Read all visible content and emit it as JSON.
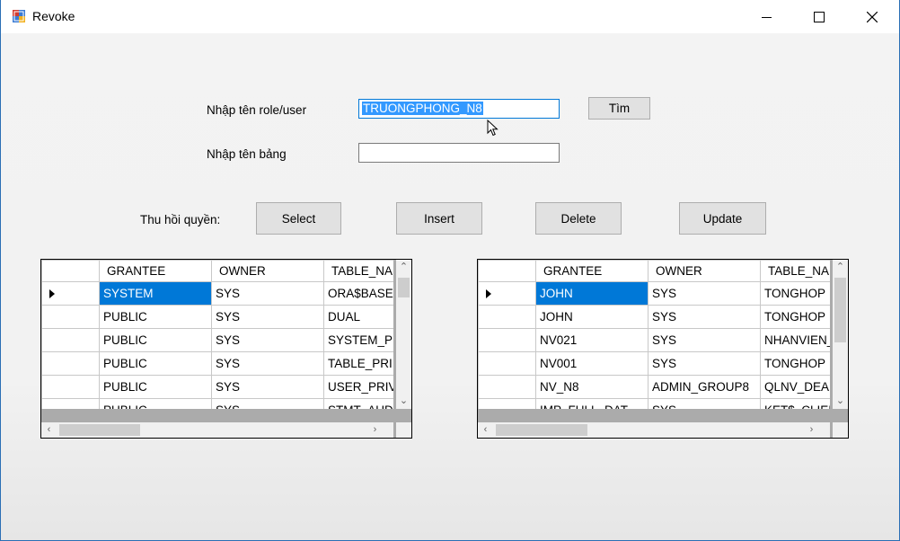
{
  "window": {
    "title": "Revoke"
  },
  "form": {
    "role_label": "Nhập tên role/user",
    "role_value": "TRUONGPHONG_N8",
    "table_label": "Nhập tên bảng",
    "table_value": "",
    "find_button": "Tìm",
    "revoke_label": "Thu hồi quyền:",
    "buttons": {
      "select": "Select",
      "insert": "Insert",
      "delete": "Delete",
      "update": "Update"
    }
  },
  "left_grid": {
    "columns": [
      "GRANTEE",
      "OWNER",
      "TABLE_NA"
    ],
    "rows": [
      [
        "SYSTEM",
        "SYS",
        "ORA$BASE"
      ],
      [
        "PUBLIC",
        "SYS",
        "DUAL"
      ],
      [
        "PUBLIC",
        "SYS",
        "SYSTEM_PI"
      ],
      [
        "PUBLIC",
        "SYS",
        "TABLE_PRI"
      ],
      [
        "PUBLIC",
        "SYS",
        "USER_PRIV"
      ],
      [
        "PUBLIC",
        "SYS",
        "STMT_AUD"
      ]
    ]
  },
  "right_grid": {
    "columns": [
      "GRANTEE",
      "OWNER",
      "TABLE_NA"
    ],
    "rows": [
      [
        "JOHN",
        "SYS",
        "TONGHOP"
      ],
      [
        "JOHN",
        "SYS",
        "TONGHOP"
      ],
      [
        "NV021",
        "SYS",
        "NHANVIEN_"
      ],
      [
        "NV001",
        "SYS",
        "TONGHOP"
      ],
      [
        "NV_N8",
        "ADMIN_GROUP8",
        "QLNV_DEA"
      ],
      [
        "IMP_FULL_DAT",
        "SYS",
        "KET$_CLIEI"
      ]
    ]
  }
}
